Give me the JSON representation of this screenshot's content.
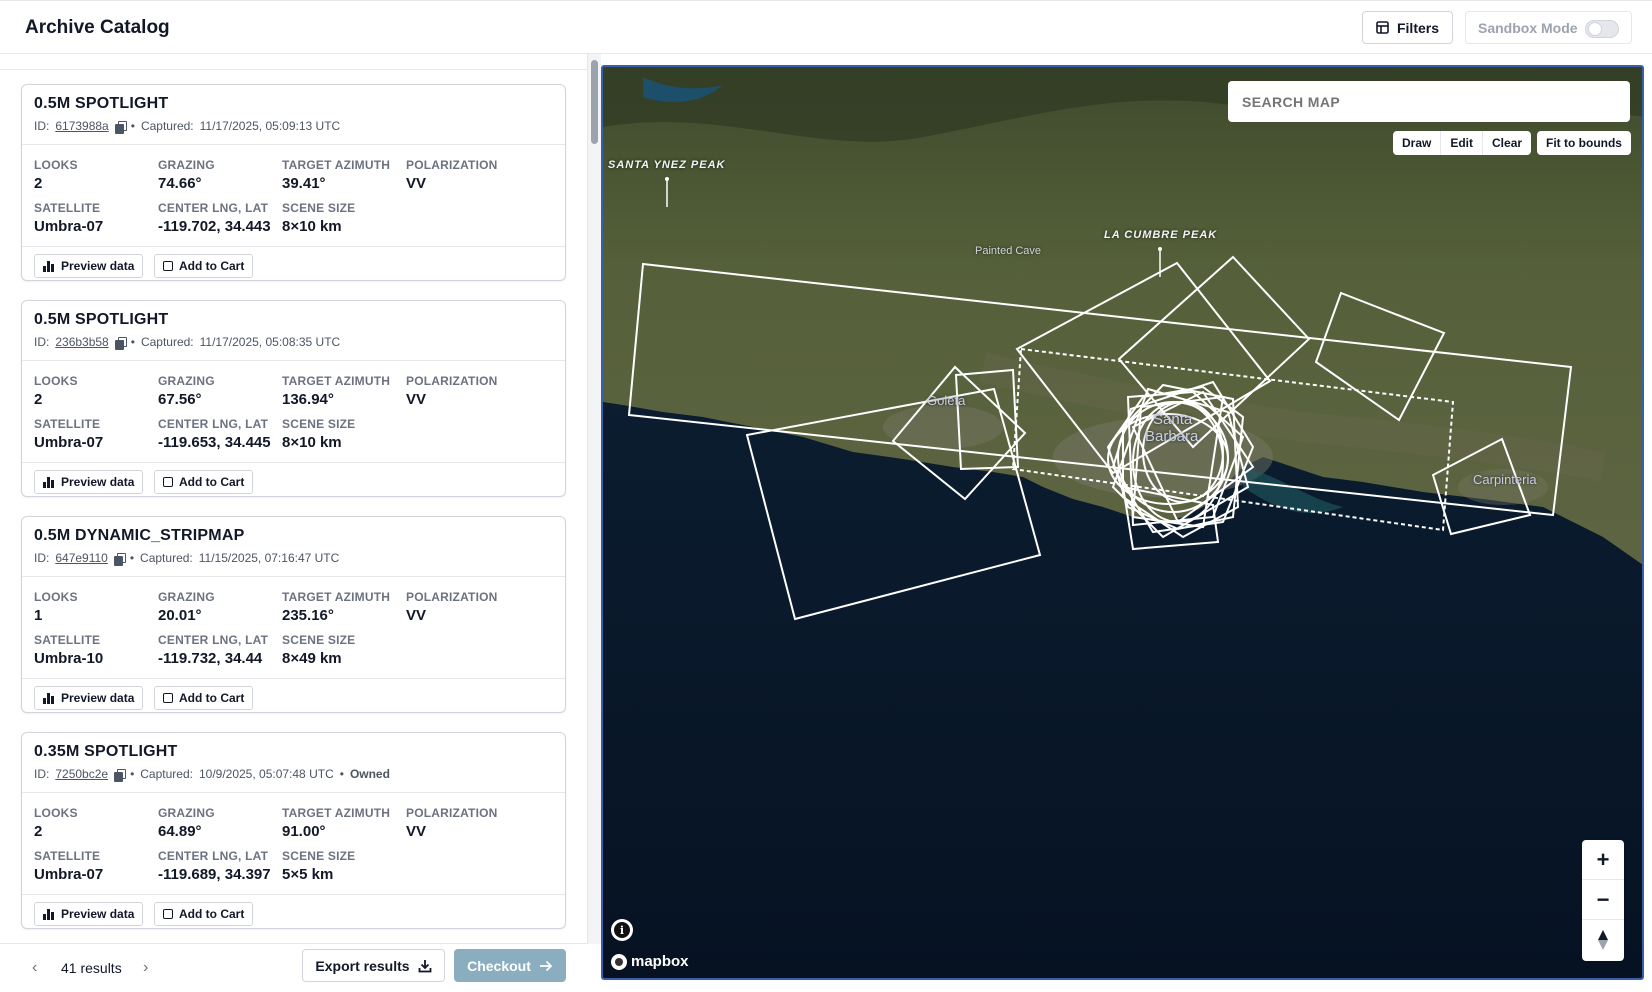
{
  "header": {
    "title": "Archive Catalog",
    "filters_label": "Filters",
    "sandbox_label": "Sandbox Mode",
    "sandbox_on": false
  },
  "labels": {
    "looks": "LOOKS",
    "grazing": "GRAZING",
    "target_azimuth": "TARGET AZIMUTH",
    "polarization": "POLARIZATION",
    "satellite": "SATELLITE",
    "center": "CENTER LNG, LAT",
    "scene_size": "SCENE SIZE",
    "preview": "Preview data",
    "add_to_cart": "Add to Cart",
    "id_prefix": "ID:",
    "captured_prefix": "Captured:"
  },
  "results": [
    {
      "title": "0.5M SPOTLIGHT",
      "id": "6173988a",
      "captured": "11/17/2025, 05:09:13 UTC",
      "owned": "",
      "looks": "2",
      "grazing": "74.66°",
      "azimuth": "39.41°",
      "polarization": "VV",
      "satellite": "Umbra-07",
      "center": "-119.702, 34.443",
      "scene_size": "8×10 km"
    },
    {
      "title": "0.5M SPOTLIGHT",
      "id": "236b3b58",
      "captured": "11/17/2025, 05:08:35 UTC",
      "owned": "",
      "looks": "2",
      "grazing": "67.56°",
      "azimuth": "136.94°",
      "polarization": "VV",
      "satellite": "Umbra-07",
      "center": "-119.653, 34.445",
      "scene_size": "8×10 km"
    },
    {
      "title": "0.5M DYNAMIC_STRIPMAP",
      "id": "647e9110",
      "captured": "11/15/2025, 07:16:47 UTC",
      "owned": "",
      "looks": "1",
      "grazing": "20.01°",
      "azimuth": "235.16°",
      "polarization": "VV",
      "satellite": "Umbra-10",
      "center": "-119.732, 34.44",
      "scene_size": "8×49 km"
    },
    {
      "title": "0.35M SPOTLIGHT",
      "id": "7250bc2e",
      "captured": "10/9/2025, 05:07:48 UTC",
      "owned": "Owned",
      "looks": "2",
      "grazing": "64.89°",
      "azimuth": "91.00°",
      "polarization": "VV",
      "satellite": "Umbra-07",
      "center": "-119.689, 34.397",
      "scene_size": "5×5 km"
    }
  ],
  "footer": {
    "results_count": "41 results",
    "export_label": "Export results",
    "checkout_label": "Checkout"
  },
  "map": {
    "search_placeholder": "SEARCH MAP",
    "draw": "Draw",
    "edit": "Edit",
    "clear": "Clear",
    "fit": "Fit to bounds",
    "attribution": "mapbox",
    "places": {
      "santa_ynez": "SANTA YNEZ PEAK",
      "la_cumbre": "LA CUMBRE PEAK",
      "painted_cave": "Painted Cave",
      "goleta": "Goleta",
      "santa_barbara_1": "Santa",
      "santa_barbara_2": "Barbara",
      "carpinteria": "Carpinteria"
    }
  },
  "colors": {
    "accent": "#3b5ea8",
    "checkout": "#8aaebf",
    "footprint": "#ffffff"
  }
}
